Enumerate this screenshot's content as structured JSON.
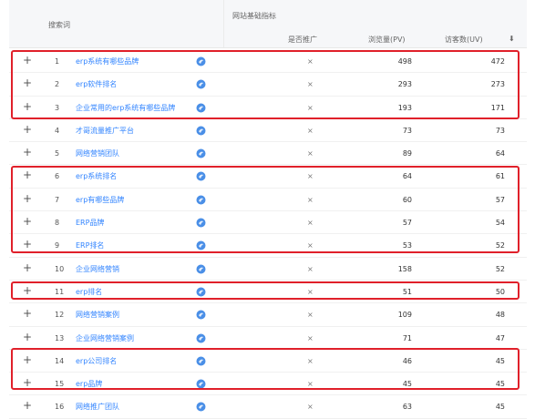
{
  "header": {
    "keyword_col": "搜索词",
    "group_col": "网站基础指标",
    "promoted_col": "是否推广",
    "pv_col": "浏览量(PV)",
    "uv_col": "访客数(UV)",
    "sort_icon": "arrow-down-icon"
  },
  "rows": [
    {
      "plus": "+",
      "index": "1",
      "keyword": "erp系统有哪些品牌",
      "promoted": "×",
      "pv": "498",
      "uv": "472"
    },
    {
      "plus": "+",
      "index": "2",
      "keyword": "erp软件排名",
      "promoted": "×",
      "pv": "293",
      "uv": "273"
    },
    {
      "plus": "+",
      "index": "3",
      "keyword": "企业常用的erp系统有哪些品牌",
      "promoted": "×",
      "pv": "193",
      "uv": "171"
    },
    {
      "plus": "+",
      "index": "4",
      "keyword": "才哥流量推广平台",
      "promoted": "×",
      "pv": "73",
      "uv": "73"
    },
    {
      "plus": "+",
      "index": "5",
      "keyword": "网络营销团队",
      "promoted": "×",
      "pv": "89",
      "uv": "64"
    },
    {
      "plus": "+",
      "index": "6",
      "keyword": "erp系统排名",
      "promoted": "×",
      "pv": "64",
      "uv": "61"
    },
    {
      "plus": "+",
      "index": "7",
      "keyword": "erp有哪些品牌",
      "promoted": "×",
      "pv": "60",
      "uv": "57"
    },
    {
      "plus": "+",
      "index": "8",
      "keyword": "ERP品牌",
      "promoted": "×",
      "pv": "57",
      "uv": "54"
    },
    {
      "plus": "+",
      "index": "9",
      "keyword": "ERP排名",
      "promoted": "×",
      "pv": "53",
      "uv": "52"
    },
    {
      "plus": "+",
      "index": "10",
      "keyword": "企业网络营销",
      "promoted": "×",
      "pv": "158",
      "uv": "52"
    },
    {
      "plus": "+",
      "index": "11",
      "keyword": "erp排名",
      "promoted": "×",
      "pv": "51",
      "uv": "50"
    },
    {
      "plus": "+",
      "index": "12",
      "keyword": "网络营销案例",
      "promoted": "×",
      "pv": "109",
      "uv": "48"
    },
    {
      "plus": "+",
      "index": "13",
      "keyword": "企业网络营销案例",
      "promoted": "×",
      "pv": "71",
      "uv": "47"
    },
    {
      "plus": "+",
      "index": "14",
      "keyword": "erp公司排名",
      "promoted": "×",
      "pv": "46",
      "uv": "45"
    },
    {
      "plus": "+",
      "index": "15",
      "keyword": "erp品牌",
      "promoted": "×",
      "pv": "45",
      "uv": "45"
    },
    {
      "plus": "+",
      "index": "16",
      "keyword": "网络推广团队",
      "promoted": "×",
      "pv": "63",
      "uv": "45"
    }
  ],
  "colors": {
    "link": "#3385ff",
    "highlight_border": "#e0202a",
    "header_bg": "#f6f7f9"
  },
  "row_icon": "search-engine-icon"
}
